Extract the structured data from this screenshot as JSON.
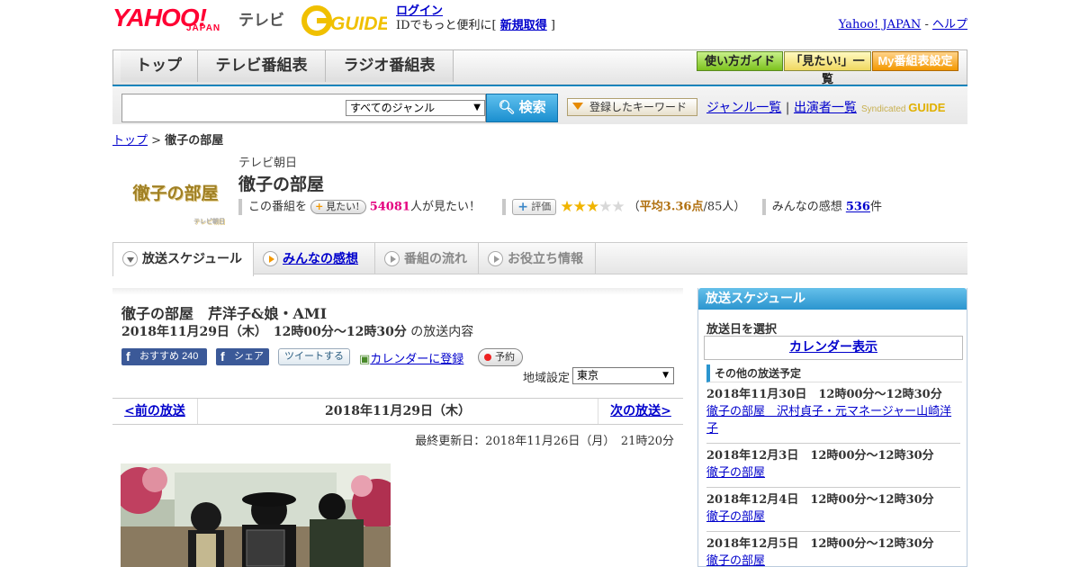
{
  "header": {
    "yahoo_logo": "YAHOO!",
    "yahoo_sub": "JAPAN",
    "tv_label": "テレビ",
    "gguide_logo": "G-GUIDE",
    "login_link": "ログイン",
    "login_text_prefix": "IDでもっと便利に[ ",
    "signup_link": "新規取得",
    "login_text_suffix": " ]",
    "yahoo_japan_link": "Yahoo! JAPAN",
    "sep": " - ",
    "help_link": "ヘルプ"
  },
  "gnav": {
    "tabs": [
      "トップ",
      "テレビ番組表",
      "ラジオ番組表"
    ],
    "right_buttons": [
      "使い方ガイド",
      "「見たい!」一覧",
      "My番組表設定"
    ]
  },
  "search": {
    "query": "",
    "genre": "すべてのジャンル",
    "button_label": "検索",
    "keyword_button": "登録したキーワード",
    "genre_link": "ジャンル一覧",
    "divider": "|",
    "performer_link": "出演者一覧",
    "syndicated": "Syndicated",
    "syndicated_logo": "GUIDE"
  },
  "breadcrumb": {
    "home": "トップ",
    "sep": " > ",
    "current": "徹子の部屋"
  },
  "program": {
    "logo_text": "徹子の部屋",
    "logo_credit": "テレビ朝日",
    "station": "テレビ朝日",
    "title": "徹子の部屋",
    "want_prefix": "この番組を",
    "want_button": "見たい!",
    "want_count": "54081",
    "want_suffix": "人が見たい！",
    "eval_button": "評価",
    "rating_stars": 3.36,
    "rating_open": "（",
    "rating_avg": "平均3.36点",
    "rating_count": "/85人）",
    "impressions_prefix": "みんなの感想",
    "impressions_count": "536",
    "impressions_suffix": "件"
  },
  "tabs": [
    {
      "label": "放送スケジュール",
      "active": true
    },
    {
      "label": "みんなの感想",
      "link": true
    },
    {
      "label": "番組の流れ"
    },
    {
      "label": "お役立ち情報"
    }
  ],
  "episode": {
    "title": "徹子の部屋　芹洋子&娘・AMI",
    "date": "2018年11月29日（木）　12時00分～12時30分",
    "date_suffix": " の放送内容",
    "fb_recommend": "おすすめ",
    "fb_recommend_count": "240",
    "fb_share": "シェア",
    "tweet": "ツイートする",
    "calendar": "カレンダーに登録",
    "reserve": "予約",
    "region_label": "地域設定",
    "region_value": "東京"
  },
  "pager": {
    "prev": "<前の放送",
    "current": "2018年11月29日（木）",
    "next": "次の放送>"
  },
  "updated": "最終更新日：2018年11月26日（月）　21時20分",
  "sidebar": {
    "title": "放送スケジュール",
    "select_label": "放送日を選択",
    "calendar_link": "カレンダー表示",
    "other_label": "その他の放送予定",
    "items": [
      {
        "date": "2018年11月30日　12時00分～12時30分",
        "title": "徹子の部屋　沢村貞子・元マネージャー山崎洋子"
      },
      {
        "date": "2018年12月3日　12時00分～12時30分",
        "title": "徹子の部屋"
      },
      {
        "date": "2018年12月4日　12時00分～12時30分",
        "title": "徹子の部屋"
      },
      {
        "date": "2018年12月5日　12時00分～12時30分",
        "title": "徹子の部屋"
      }
    ]
  }
}
